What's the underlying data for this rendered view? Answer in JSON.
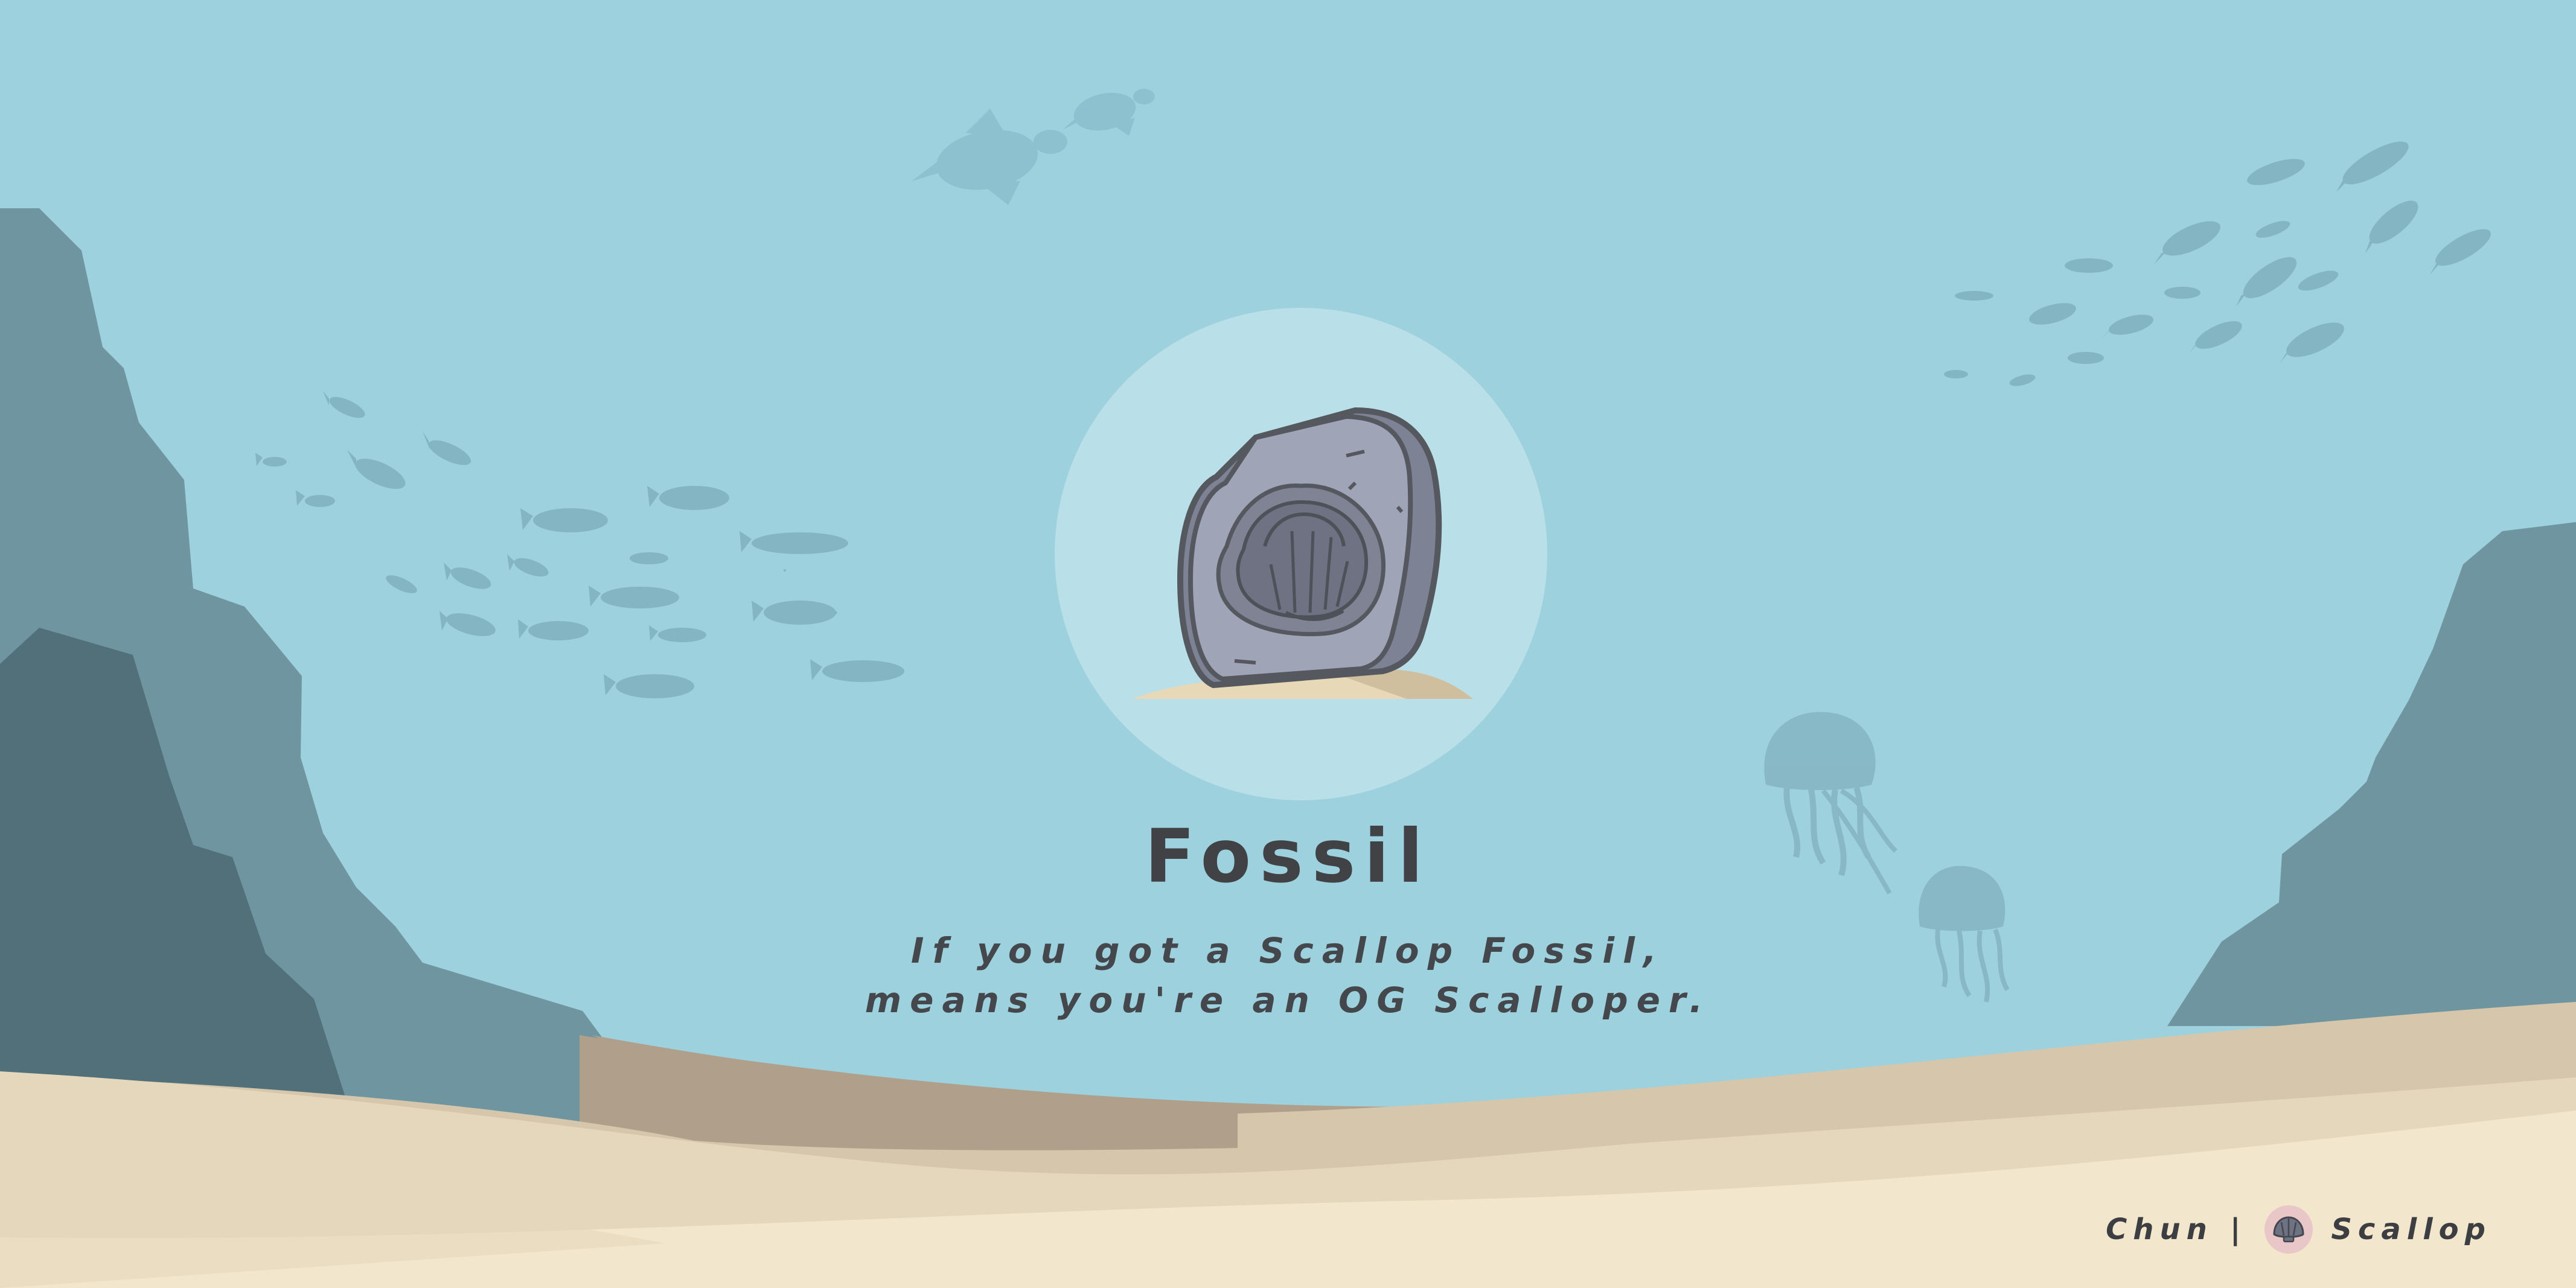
{
  "poster": {
    "title": "Fossil",
    "tagline_line1": "If you got a Scallop Fossil,",
    "tagline_line2": "means you're an OG Scalloper."
  },
  "credit": {
    "author": "Chun",
    "separator": "|",
    "brand": "Scallop",
    "brand_icon": "scallop-shell-icon"
  },
  "illustration": {
    "subject": "scallop-fossil-stone",
    "decorations": [
      "fish-school-icon",
      "sea-turtle-icon",
      "jellyfish-icon",
      "rock-cliff",
      "sand-dunes"
    ]
  },
  "colors": {
    "water": "#9dd1de",
    "halo": "#b9dfe8",
    "rock_light": "#6f95a0",
    "rock_dark": "#517079",
    "sand_light": "#f2e6cd",
    "sand_mid": "#d6c7ac",
    "sand_dark": "#b09f8a",
    "fossil": "#8f94a6",
    "text": "#404245"
  }
}
